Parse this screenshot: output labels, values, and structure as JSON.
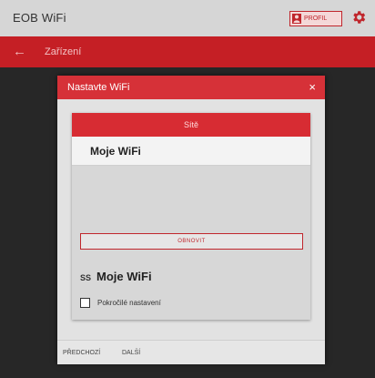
{
  "app": {
    "title": "EOB WiFi",
    "profile_label": "PROFIL",
    "accent_color": "#c51f25"
  },
  "subheader": {
    "back_symbol": "←",
    "title": "Zařízení"
  },
  "dialog": {
    "title": "Nastavte WiFi",
    "close_symbol": "×",
    "tab_label": "Sítě",
    "network_name": "Moje WiFi",
    "refresh_label": "OBNOVIT",
    "selected_network_prefix": "SS",
    "selected_network_name": "Moje WiFi",
    "advanced_label": "Pokročilé nastavení",
    "advanced_checked": false,
    "footer_back": "PŘEDCHOZÍ",
    "footer_next": "DALŠÍ"
  },
  "icons": {
    "profile": "person-icon",
    "settings": "gear-icon",
    "back": "arrow-left-icon",
    "close": "close-icon",
    "wifi": "wifi-icon"
  }
}
